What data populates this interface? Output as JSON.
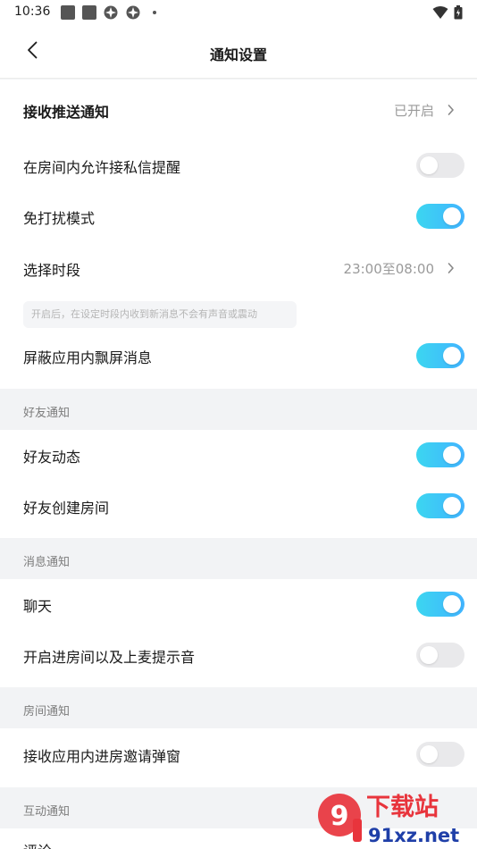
{
  "status_bar": {
    "time": "10:36",
    "icons": [
      "square-notification-icon",
      "square-notification-icon",
      "aperture-icon",
      "aperture-icon",
      "dot-icon",
      "wifi-icon",
      "battery-icon"
    ]
  },
  "nav": {
    "title": "通知设置",
    "back_icon": "chevron-left-icon"
  },
  "settings": {
    "receive_push": {
      "label": "接收推送通知",
      "value": "已开启"
    },
    "dm_in_room": {
      "label": "在房间内允许接私信提醒",
      "on": false
    },
    "dnd": {
      "label": "免打扰模式",
      "on": true
    },
    "period": {
      "label": "选择时段",
      "value": "23:00至08:00"
    },
    "dnd_hint": "开启后，在设定时段内收到新消息不会有声音或震动",
    "block_floating": {
      "label": "屏蔽应用内飘屏消息",
      "on": true
    }
  },
  "sections": {
    "friends": {
      "title": "好友通知",
      "moments": {
        "label": "好友动态",
        "on": true
      },
      "create_room": {
        "label": "好友创建房间",
        "on": true
      }
    },
    "messages": {
      "title": "消息通知",
      "chat": {
        "label": "聊天",
        "on": true
      },
      "room_sound": {
        "label": "开启进房间以及上麦提示音",
        "on": false
      }
    },
    "room": {
      "title": "房间通知",
      "invite_popup": {
        "label": "接收应用内进房邀请弹窗",
        "on": false
      }
    },
    "interaction": {
      "title": "互动通知",
      "comment": {
        "label": "评论"
      }
    }
  },
  "watermark": {
    "brand": "下载站",
    "site": "91xz.net"
  },
  "colors": {
    "toggle_on_start": "#3cd6f0",
    "toggle_on_end": "#41b4ff",
    "toggle_off": "#e9e9eb",
    "watermark_red": "#e8343c"
  }
}
